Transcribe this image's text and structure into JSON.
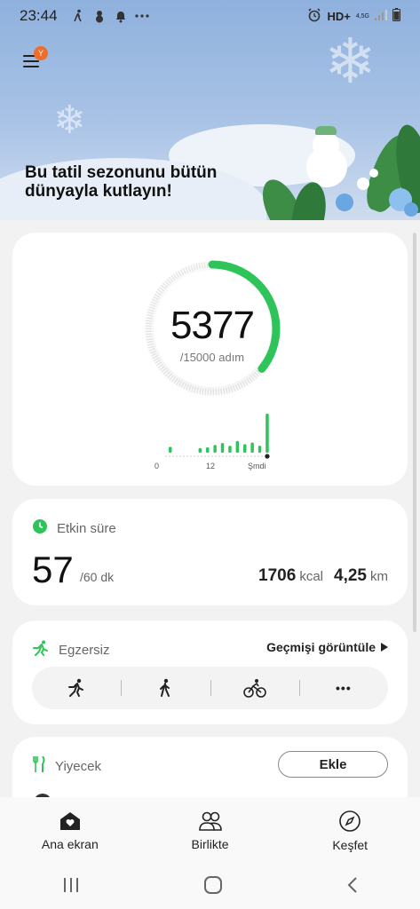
{
  "status_bar": {
    "time": "23:44",
    "network": "HD+",
    "network_small": "4,5G"
  },
  "banner": {
    "title": "Bu tatil sezonunu bütün dünyayla kutlayın!",
    "menu_badge": "Y"
  },
  "steps": {
    "count": "5377",
    "goal_label": "/15000 adım",
    "progress": 0.3585,
    "chart_ticks": [
      "0",
      "12",
      "Şmdi"
    ],
    "hourly_bars": [
      0.15,
      0,
      0,
      0,
      0.12,
      0.14,
      0.2,
      0.25,
      0.18,
      0.3,
      0.22,
      0.26,
      0.18,
      1.0
    ]
  },
  "active_time": {
    "title": "Etkin süre",
    "minutes": "57",
    "goal": "/60 dk",
    "kcal_value": "1706",
    "kcal_unit": "kcal",
    "distance_value": "4,25",
    "distance_unit": "km"
  },
  "exercise": {
    "title": "Egzersiz",
    "history_link": "Geçmişi görüntüle",
    "more_label": "•••"
  },
  "food": {
    "title": "Yiyecek",
    "add_button": "Ekle"
  },
  "bottom_nav": {
    "home": "Ana ekran",
    "together": "Birlikte",
    "discover": "Keşfet"
  },
  "colors": {
    "accent_green": "#2ec45a",
    "badge_orange": "#ef6c2a",
    "ring_track": "#e6e6e6"
  }
}
